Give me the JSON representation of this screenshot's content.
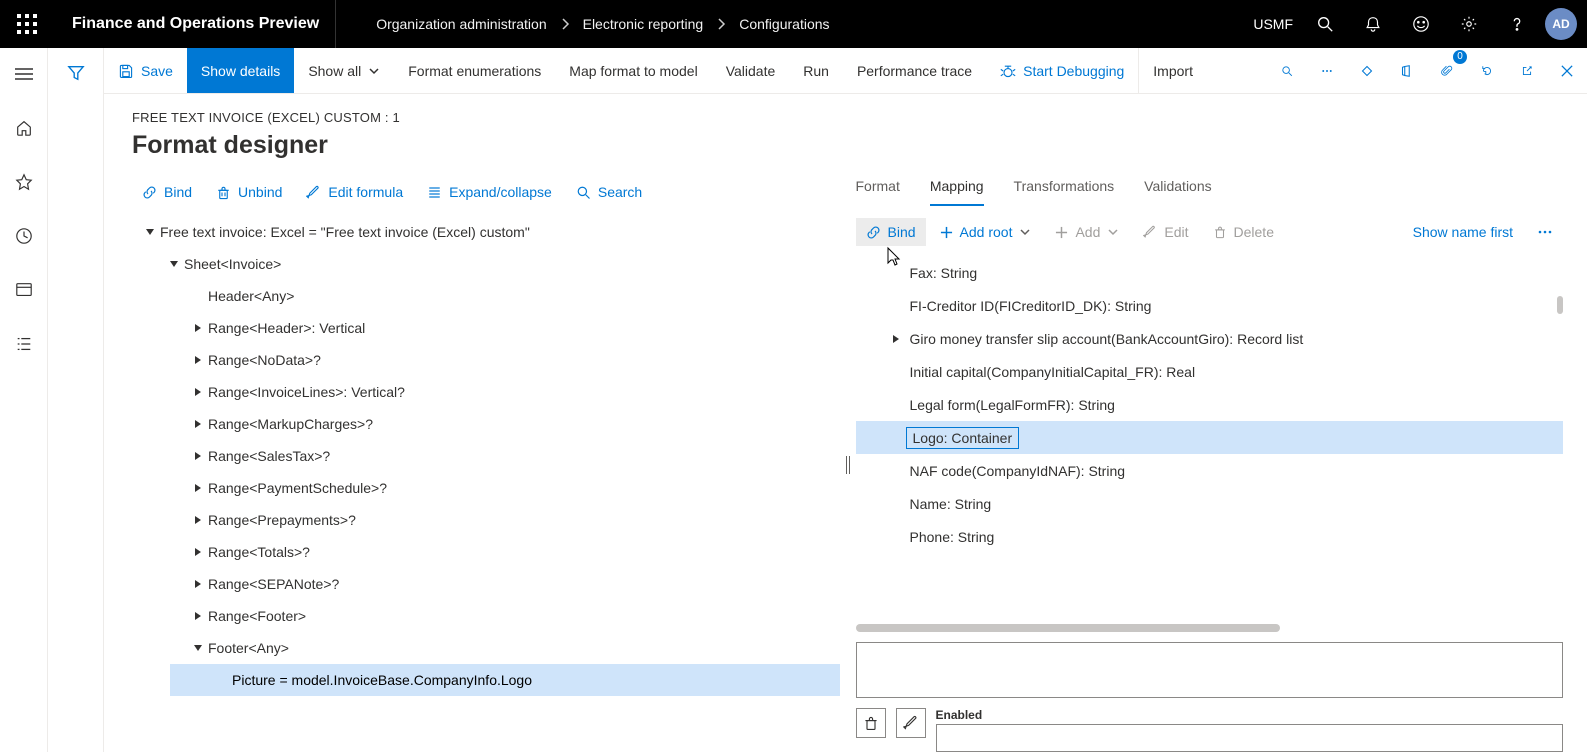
{
  "header": {
    "app_title": "Finance and Operations Preview",
    "breadcrumb": [
      "Organization administration",
      "Electronic reporting",
      "Configurations"
    ],
    "company": "USMF",
    "avatar": "AD",
    "notification_badge": "0"
  },
  "commandbar": {
    "save": "Save",
    "show_details": "Show details",
    "show_all": "Show all",
    "format_enum": "Format enumerations",
    "map_format": "Map format to model",
    "validate": "Validate",
    "run": "Run",
    "perf_trace": "Performance trace",
    "start_debug": "Start Debugging",
    "import": "Import"
  },
  "page": {
    "path": "FREE TEXT INVOICE (EXCEL) CUSTOM : 1",
    "title": "Format designer"
  },
  "left_toolbar": {
    "bind": "Bind",
    "unbind": "Unbind",
    "edit_formula": "Edit formula",
    "expand_collapse": "Expand/collapse",
    "search": "Search"
  },
  "right_tabs": {
    "format": "Format",
    "mapping": "Mapping",
    "transformations": "Transformations",
    "validations": "Validations"
  },
  "right_toolbar": {
    "bind": "Bind",
    "add_root": "Add root",
    "add": "Add",
    "edit": "Edit",
    "delete": "Delete",
    "show_name_first": "Show name first"
  },
  "format_tree": [
    {
      "depth": 0,
      "caret": "down",
      "label": "Free text invoice: Excel = \"Free text invoice (Excel) custom\""
    },
    {
      "depth": 1,
      "caret": "down",
      "label": "Sheet<Invoice>"
    },
    {
      "depth": 2,
      "caret": "none",
      "label": "Header<Any>"
    },
    {
      "depth": 2,
      "caret": "right",
      "label": "Range<Header>: Vertical"
    },
    {
      "depth": 2,
      "caret": "right",
      "label": "Range<NoData>?"
    },
    {
      "depth": 2,
      "caret": "right",
      "label": "Range<InvoiceLines>: Vertical?"
    },
    {
      "depth": 2,
      "caret": "right",
      "label": "Range<MarkupCharges>?"
    },
    {
      "depth": 2,
      "caret": "right",
      "label": "Range<SalesTax>?"
    },
    {
      "depth": 2,
      "caret": "right",
      "label": "Range<PaymentSchedule>?"
    },
    {
      "depth": 2,
      "caret": "right",
      "label": "Range<Prepayments>?"
    },
    {
      "depth": 2,
      "caret": "right",
      "label": "Range<Totals>?"
    },
    {
      "depth": 2,
      "caret": "right",
      "label": "Range<SEPANote>?"
    },
    {
      "depth": 2,
      "caret": "right",
      "label": "Range<Footer>"
    },
    {
      "depth": 2,
      "caret": "down",
      "label": "Footer<Any>"
    },
    {
      "depth": 3,
      "caret": "none",
      "label": "Picture = model.InvoiceBase.CompanyInfo.Logo",
      "selected": true
    }
  ],
  "data_tree": [
    {
      "caret": "none",
      "label": "Fax: String"
    },
    {
      "caret": "none",
      "label": "FI-Creditor ID(FICreditorID_DK): String"
    },
    {
      "caret": "right",
      "label": "Giro money transfer slip account(BankAccountGiro): Record list"
    },
    {
      "caret": "none",
      "label": "Initial capital(CompanyInitialCapital_FR): Real"
    },
    {
      "caret": "none",
      "label": "Legal form(LegalFormFR): String"
    },
    {
      "caret": "none",
      "label": "Logo: Container",
      "selected": true
    },
    {
      "caret": "none",
      "label": "NAF code(CompanyIdNAF): String"
    },
    {
      "caret": "none",
      "label": "Name: String"
    },
    {
      "caret": "none",
      "label": "Phone: String"
    }
  ],
  "enabled_label": "Enabled"
}
